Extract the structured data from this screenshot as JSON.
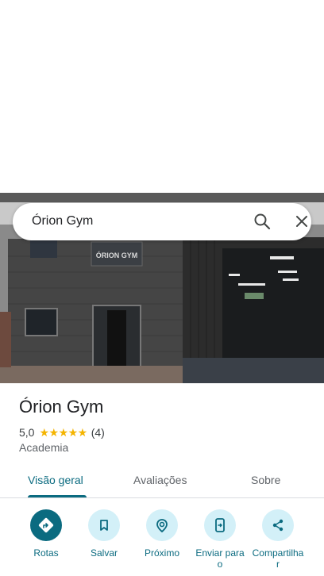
{
  "search": {
    "query": "Órion Gym"
  },
  "photo": {
    "sign_text": "ÓRION GYM"
  },
  "place": {
    "name": "Órion Gym",
    "rating": "5,0",
    "stars": "★★★★★",
    "review_count": "(4)",
    "category": "Academia"
  },
  "tabs": [
    {
      "label": "Visão geral",
      "active": true
    },
    {
      "label": "Avaliações",
      "active": false
    },
    {
      "label": "Sobre",
      "active": false
    }
  ],
  "actions": [
    {
      "label": "Rotas",
      "icon": "directions-icon"
    },
    {
      "label": "Salvar",
      "icon": "bookmark-icon"
    },
    {
      "label": "Próximo",
      "icon": "nearby-icon"
    },
    {
      "label": "Enviar para\no\n",
      "icon": "send-to-phone-icon"
    },
    {
      "label": "Compartilha\nr",
      "icon": "share-icon"
    }
  ],
  "colors": {
    "accent": "#0b6b80",
    "accent_light": "#d3f0f8",
    "star": "#f4b400"
  }
}
